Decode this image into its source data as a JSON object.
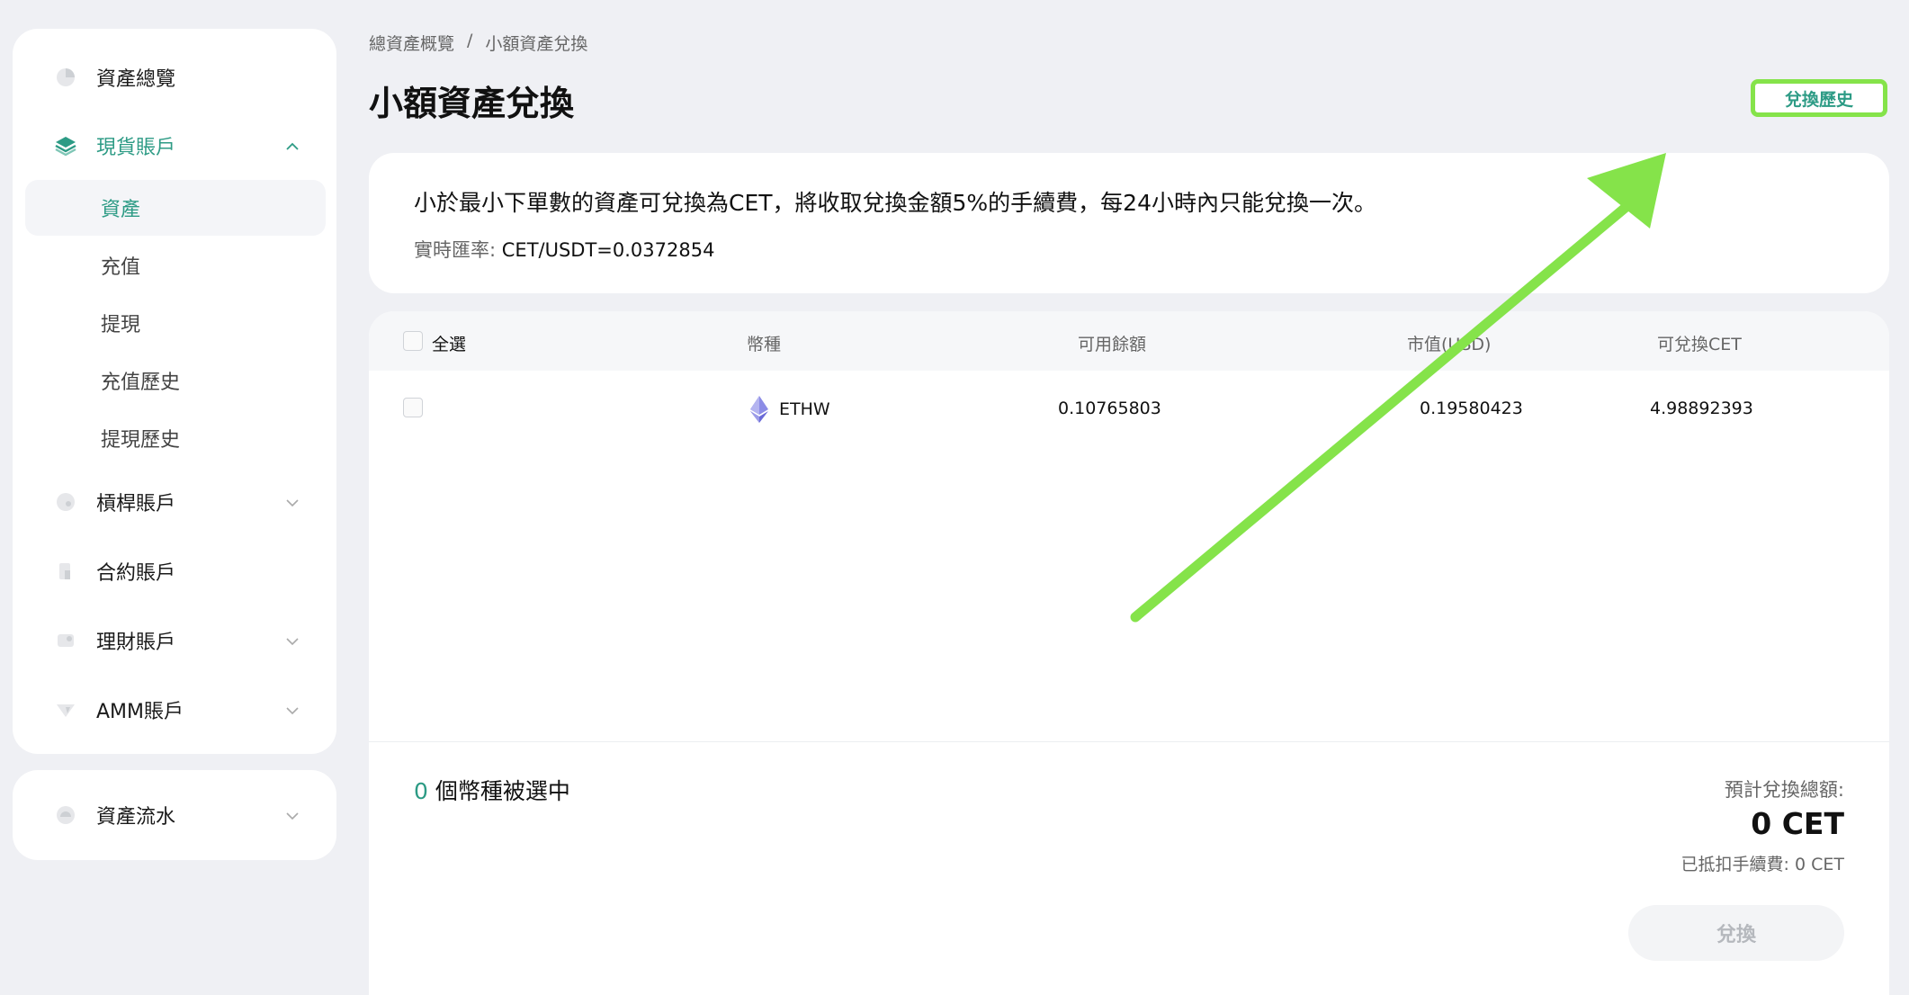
{
  "sidebar": {
    "items": [
      {
        "label": "資產總覽",
        "icon": "pie-chart-icon"
      },
      {
        "label": "現貨賬戶",
        "icon": "layers-icon",
        "active": true,
        "expanded": true
      },
      {
        "label": "槓桿賬戶",
        "icon": "leverage-icon"
      },
      {
        "label": "合約賬戶",
        "icon": "contract-icon"
      },
      {
        "label": "理財賬戶",
        "icon": "finance-icon"
      },
      {
        "label": "AMM賬戶",
        "icon": "amm-icon"
      }
    ],
    "sub_items": [
      {
        "label": "資產",
        "active": true
      },
      {
        "label": "充值"
      },
      {
        "label": "提現"
      },
      {
        "label": "充值歷史"
      },
      {
        "label": "提現歷史"
      }
    ],
    "flow": {
      "label": "資產流水",
      "icon": "flow-icon"
    }
  },
  "breadcrumb": {
    "root": "總資產概覽",
    "separator": "/",
    "current": "小額資產兌換"
  },
  "header": {
    "title": "小額資產兌換",
    "history_button": "兌換歷史"
  },
  "info": {
    "text": "小於最小下單數的資產可兌換為CET，將收取兌換金額5%的手續費，每24小時內只能兌換一次。",
    "rate_label": "實時匯率:",
    "rate_value": "CET/USDT=0.0372854"
  },
  "table": {
    "headers": {
      "select_all": "全選",
      "coin": "幣種",
      "available": "可用餘額",
      "market_value": "市值(USD)",
      "convertible": "可兌換CET"
    },
    "rows": [
      {
        "coin": "ETHW",
        "available": "0.10765803",
        "market_value": "0.19580423",
        "convertible": "4.98892393"
      }
    ]
  },
  "footer": {
    "selected_count": "0",
    "selected_label": "個幣種被選中",
    "estimate_label": "預計兌換總額:",
    "estimate_value": "0 CET",
    "fee_line": "已抵扣手續費: 0 CET",
    "convert_button": "兌換"
  },
  "colors": {
    "accent": "#2d9b85",
    "highlight": "#85e34a"
  }
}
